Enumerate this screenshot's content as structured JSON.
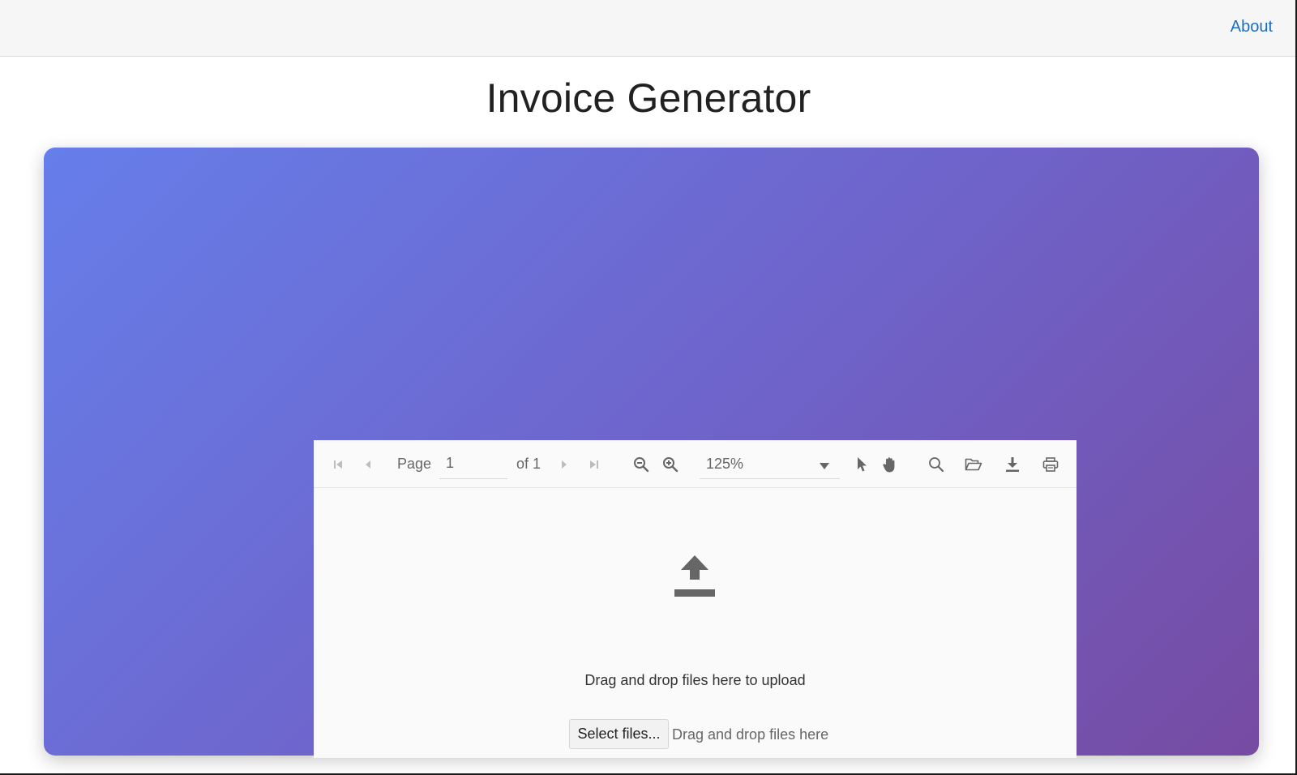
{
  "header": {
    "about_label": "About"
  },
  "page": {
    "title": "Invoice Generator"
  },
  "viewer": {
    "toolbar": {
      "page_label": "Page",
      "page_value": "1",
      "of_label": "of 1",
      "zoom_value": "125%"
    },
    "icons": [
      "first-page-icon",
      "previous-page-icon",
      "next-page-icon",
      "last-page-icon",
      "zoom-out-icon",
      "zoom-in-icon",
      "chevron-down-icon",
      "pointer-icon",
      "hand-pan-icon",
      "search-icon",
      "folder-open-icon",
      "download-icon",
      "print-icon",
      "upload-icon"
    ],
    "dropzone": {
      "hint": "Drag and drop files here to upload",
      "select_button": "Select files...",
      "drop_label": "Drag and drop files here"
    }
  },
  "colors": {
    "gradient_start": "#667eea",
    "gradient_end": "#764ba2",
    "link": "#1a6fc4",
    "icon": "#666666"
  }
}
